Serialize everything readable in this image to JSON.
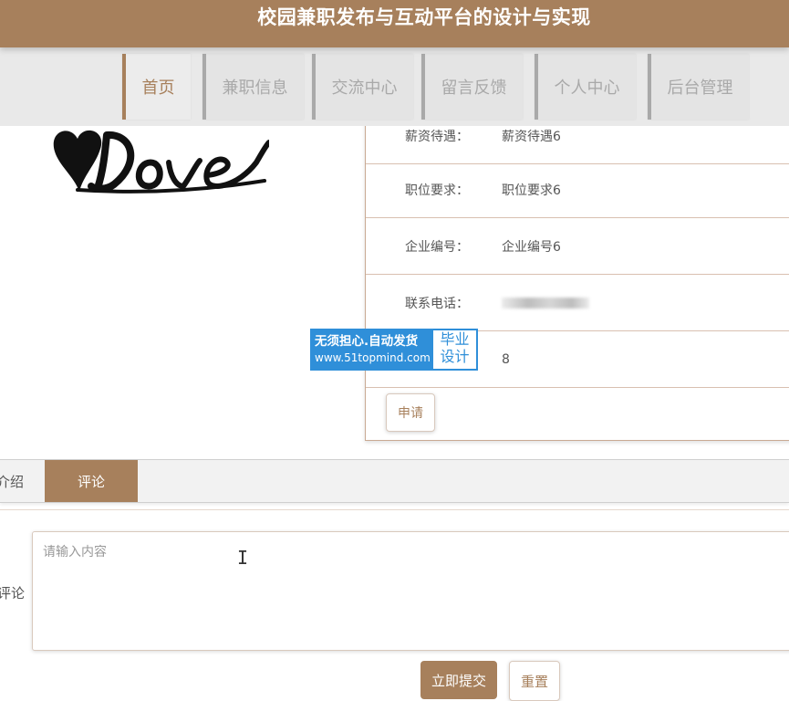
{
  "header": {
    "title": "校园兼职发布与互动平台的设计与实现"
  },
  "nav": {
    "items": [
      {
        "label": "首页",
        "active": true
      },
      {
        "label": "兼职信息",
        "active": false
      },
      {
        "label": "交流中心",
        "active": false
      },
      {
        "label": "留言反馈",
        "active": false
      },
      {
        "label": "个人中心",
        "active": false
      },
      {
        "label": "后台管理",
        "active": false
      }
    ]
  },
  "details": {
    "rows": [
      {
        "label": "薪资待遇：",
        "value": "薪资待遇6"
      },
      {
        "label": "职位要求：",
        "value": "职位要求6"
      },
      {
        "label": "企业编号：",
        "value": "企业编号6"
      },
      {
        "label": "联系电话：",
        "value": ""
      },
      {
        "label": "",
        "value": "8"
      }
    ],
    "apply_label": "申请"
  },
  "watermark": {
    "line1": "无须担心.自动发货",
    "line2": "www.51topmind.com",
    "badge_line1": "毕业",
    "badge_line2": "设计",
    "color": "#2f8fd9"
  },
  "tabs": [
    {
      "label": "介绍",
      "active": false
    },
    {
      "label": "评论",
      "active": true
    }
  ],
  "comment": {
    "label": "评论",
    "placeholder": "请输入内容",
    "value": "",
    "submit_label": "立即提交",
    "reset_label": "重置"
  },
  "colors": {
    "accent": "#a7805c",
    "nav_bg": "#e9e9e9",
    "nav_inactive": "#a9a9a9"
  },
  "icons": {
    "text_cursor": "i-beam-cursor-icon"
  }
}
